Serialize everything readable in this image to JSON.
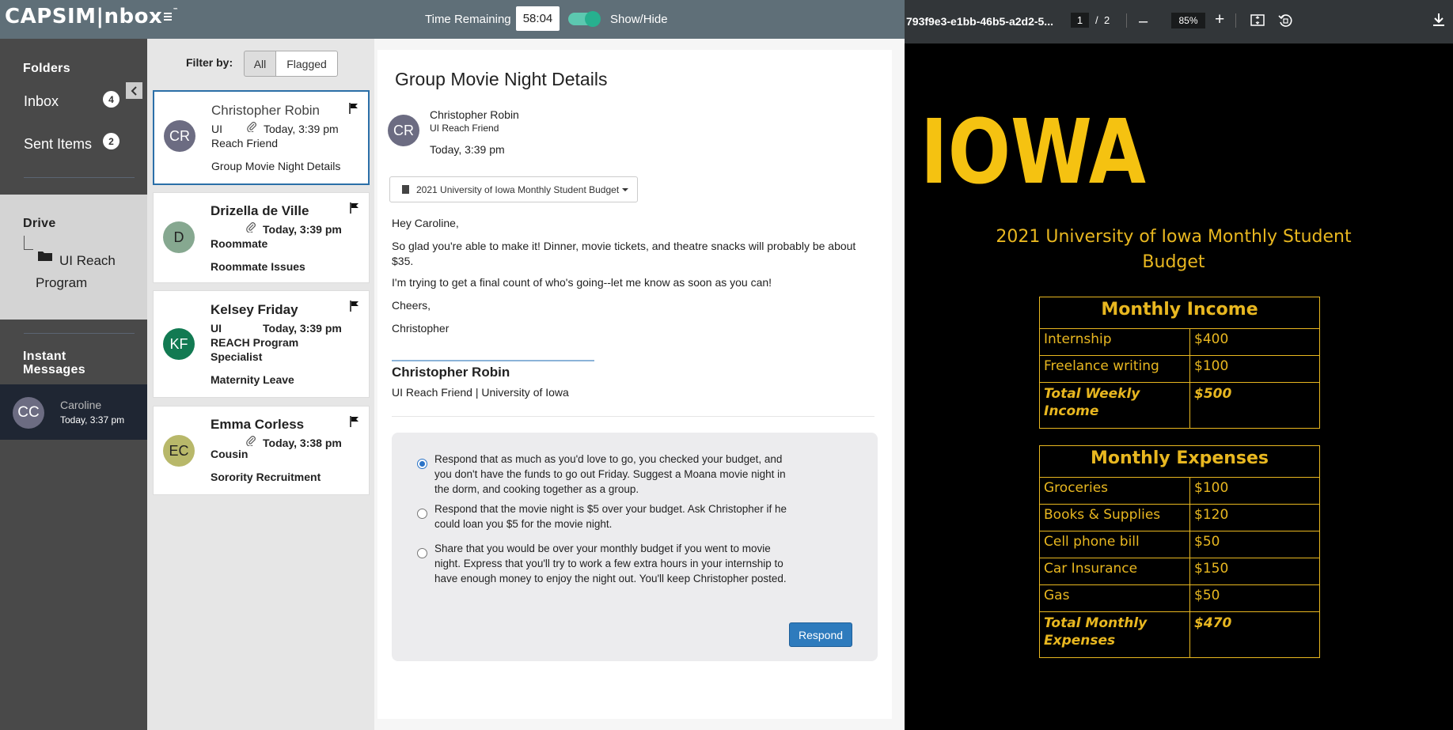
{
  "header": {
    "logo_text": "CAPSIM|nbox",
    "logo_tm": "™",
    "time_remaining_label": "Time Remaining",
    "time_remaining_value": "58:04",
    "show_hide_label": "Show/Hide",
    "show_hide_on": true,
    "accent_color": "#27b08f"
  },
  "sidebar": {
    "folders_title": "Folders",
    "folders": [
      {
        "label": "Inbox",
        "count": "4"
      },
      {
        "label": "Sent Items",
        "count": "2"
      }
    ],
    "drive_title": "Drive",
    "drive_item": "UI Reach Program",
    "instant_messages_title": "Instant Messages",
    "im": {
      "initials": "CC",
      "name": "Caroline",
      "time": "Today, 3:37 pm"
    }
  },
  "list": {
    "filter_label": "Filter by:",
    "filter_all": "All",
    "filter_flagged": "Flagged",
    "messages": [
      {
        "initials": "CR",
        "name": "Christopher Robin",
        "role_a": "UI",
        "time": "Today, 3:39 pm",
        "role_b": "Reach Friend",
        "subject": "Group Movie Night Details",
        "color": "#6c6c82"
      },
      {
        "initials": "D",
        "name": "Drizella de Ville",
        "role_a": "",
        "time": "Today, 3:39 pm",
        "role_b": "Roommate",
        "subject": "Roommate Issues",
        "color": "#86a890"
      },
      {
        "initials": "KF",
        "name": "Kelsey Friday",
        "role_a": "UI",
        "time": "Today, 3:39 pm",
        "role_b": "REACH Program",
        "role_c": "Specialist",
        "subject": "Maternity Leave",
        "color": "#127a52"
      },
      {
        "initials": "EC",
        "name": "Emma Corless",
        "role_a": "",
        "time": "Today, 3:38 pm",
        "role_b": "Cousin",
        "subject": "Sorority Recruitment",
        "color": "#b8b86a"
      }
    ]
  },
  "detail": {
    "subject": "Group Movie Night Details",
    "initials": "CR",
    "from": "Christopher Robin",
    "role": "UI Reach Friend",
    "time": "Today, 3:39 pm",
    "attachment": "2021 University of Iowa Monthly Student Budget",
    "body": [
      "Hey Caroline,",
      "So glad you're able to make it! Dinner, movie tickets, and theatre snacks will probably be about $35.",
      "I'm trying to get a final count of who's going--let me know as soon as you can!",
      "Cheers,",
      "Christopher"
    ],
    "signature_name": "Christopher Robin",
    "signature_org": "UI Reach Friend | University of Iowa",
    "options": [
      {
        "text": "Respond that as much as you'd love to go, you checked your budget, and you don't have the funds to go out Friday. Suggest a Moana movie night in the dorm, and cooking together as a group.",
        "checked": true
      },
      {
        "text": "Respond that the movie night is $5 over your budget. Ask Christopher if he could loan you $5 for the movie night.",
        "checked": false
      },
      {
        "text": "Share that you would be over your monthly budget if you went to movie night. Express that you'll try to work a few extra hours in your internship to have enough money to enjoy the night out. You'll keep Christopher posted.",
        "checked": false
      }
    ],
    "respond_label": "Respond"
  },
  "pdf": {
    "title": "793f9e3-e1bb-46b5-a2d2-5...",
    "page": "1",
    "slash": "/",
    "total": "2",
    "zoom": "85%",
    "minus": "–",
    "plus": "+",
    "logo_text": "IOWA",
    "heading": "2021 University of Iowa Monthly Student Budget",
    "gold": "#e8b720",
    "income": {
      "title": "Monthly Income",
      "rows": [
        [
          "Internship",
          "$400"
        ],
        [
          "Freelance writing",
          "$100"
        ]
      ],
      "total": [
        "Total Weekly Income",
        "$500"
      ]
    },
    "expenses": {
      "title": "Monthly Expenses",
      "rows": [
        [
          "Groceries",
          "$100"
        ],
        [
          "Books & Supplies",
          "$120"
        ],
        [
          "Cell phone bill",
          "$50"
        ],
        [
          "Car Insurance",
          "$150"
        ],
        [
          "Gas",
          "$50"
        ]
      ],
      "total": [
        "Total Monthly Expenses",
        "$470"
      ]
    }
  }
}
